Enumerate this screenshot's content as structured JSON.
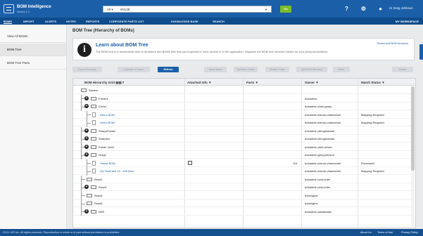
{
  "app": {
    "name": "BOM Intelligence",
    "version": "Version 1.0"
  },
  "search": {
    "scope": "All",
    "value": "6N138",
    "go_label": "Go"
  },
  "header": {
    "user_greeting": "Hi Greg Johnson"
  },
  "nav": {
    "items": [
      "BOMS",
      "IMPORT",
      "ALERTS",
      "NOTES",
      "REPORTS",
      "CORPORATE PARTS LIST",
      "KNOWLEDGE BASE",
      "SEARCH"
    ],
    "right": "MY WORKSPACE"
  },
  "sidebar": {
    "items": [
      "View All BOMs",
      "BOM Tree",
      "BOM Tree Parts"
    ]
  },
  "page": {
    "title": "BOM Tree (Hierarchy of BOMs)"
  },
  "info": {
    "title": "Learn about BOM Tree",
    "text": "The BOM tree is a hierarchical view of all folders and BOMs files that you imported or have access to in the application. Organize the BOM tree structure based on your personal workflow.",
    "link": "Reload child BOM structures"
  },
  "toolbar": {
    "buttons": [
      "Export Summary",
      "Calculate & Report",
      "Refresh",
      "Move Items",
      "Add New Folder",
      "Modify Folder",
      "Add BOM Structure",
      "Move",
      "Delete"
    ]
  },
  "grid": {
    "columns": [
      "BOM Hierarchy Grid",
      "Attached Info",
      "Parts",
      "Owner",
      "Match Status"
    ],
    "rows": [
      {
        "name": "System",
        "info": "",
        "parts": "",
        "owner": "",
        "status": ""
      },
      {
        "name": "Folder1",
        "info": "",
        "parts": "",
        "owner": "bobadmin",
        "status": ""
      },
      {
        "name": "Chris1",
        "info": "",
        "parts": "",
        "owner": "bobadmin,chris.geary",
        "status": ""
      },
      {
        "name": "Demo BOM",
        "info": "",
        "parts": "",
        "owner": "bobadmin,bmoss,chamanine",
        "status": "Mapping Required"
      },
      {
        "name": "Demo BOM",
        "info": "",
        "parts": "",
        "owner": "bobadmin,bmoss,chamanine",
        "status": "Mapping Required"
      },
      {
        "name": "SharpsFolder",
        "info": "",
        "parts": "",
        "owner": "bobadmin,dhrugmamali",
        "status": ""
      },
      {
        "name": "Sharpton",
        "info": "",
        "parts": "",
        "owner": "bobadmin,dhrugmamali",
        "status": ""
      },
      {
        "name": "Folder Jeet1",
        "info": "",
        "parts": "",
        "owner": "bobadmin,amit.viewer",
        "status": ""
      },
      {
        "name": "Greg1",
        "info": "",
        "parts": "",
        "owner": "bobadmin,greg.johnson",
        "status": ""
      },
      {
        "name": "House BOM",
        "info": "attach",
        "parts": "114",
        "owner": "bobadmin,bmoss,chamanine",
        "status": "Processed"
      },
      {
        "name": "QA TestCase 10 - 400 lines",
        "info": "",
        "parts": "",
        "owner": "bobadmin,bmoss,chamanine",
        "status": "Mapping Required"
      },
      {
        "name": "Ross2",
        "info": "",
        "parts": "",
        "owner": "bobadmin,ross,leder",
        "status": ""
      },
      {
        "name": "Ross3",
        "info": "",
        "parts": "",
        "owner": "bobadmin,ross,leder",
        "status": ""
      },
      {
        "name": "Ross5",
        "info": "",
        "parts": "",
        "owner": "bobengine",
        "status": ""
      },
      {
        "name": "Ross6",
        "info": "",
        "parts": "",
        "owner": "bobengine",
        "status": ""
      },
      {
        "name": "DEE",
        "info": "",
        "parts": "",
        "owner": "bobadmin,amalamaw",
        "status": ""
      }
    ]
  },
  "footer": {
    "copyright": "2019, IHS Inc. All rights reserved. Reproduction in whole or in part without permission is prohibited.",
    "links": [
      "About Us",
      "Terms of Use",
      "Privacy Policy"
    ]
  }
}
